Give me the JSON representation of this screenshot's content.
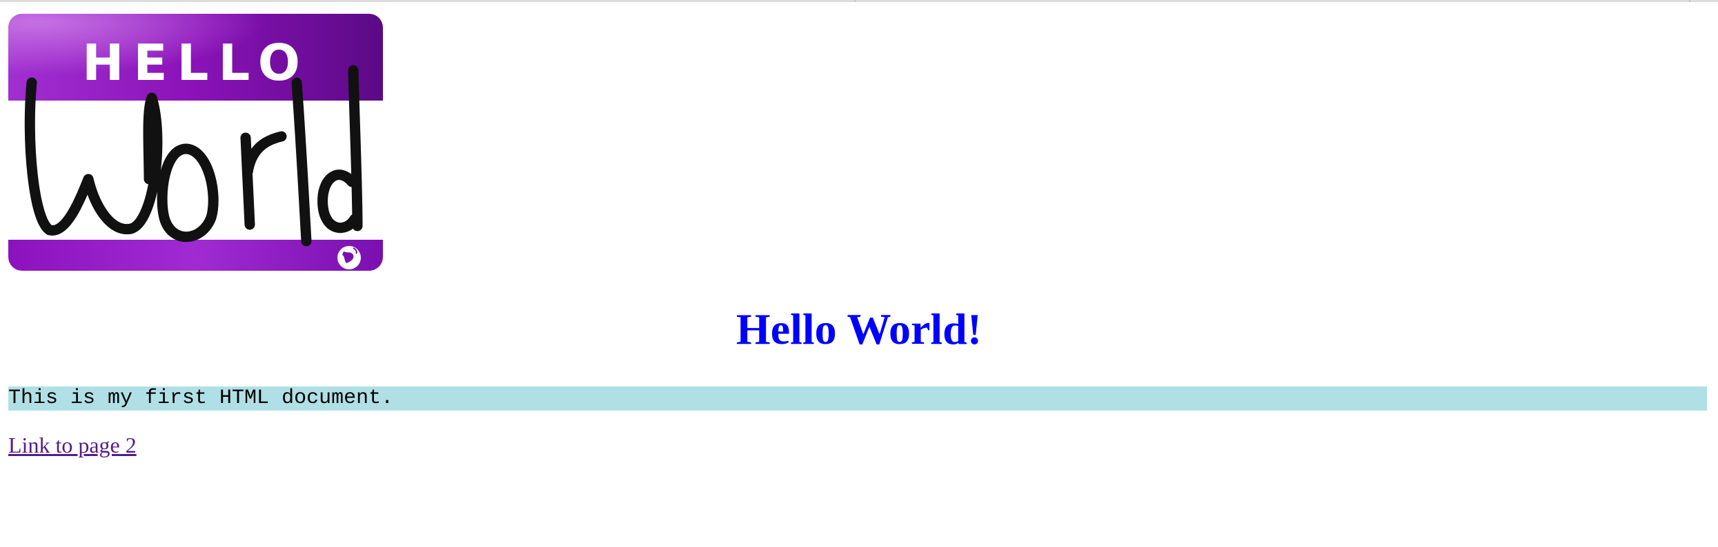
{
  "logo": {
    "title_text": "HELLO",
    "handwritten_text": "World",
    "accent_color": "#8a12b8",
    "accent_dark": "#5b0a86",
    "badge_icon": "globe-icon"
  },
  "heading": {
    "text": "Hello World!",
    "color": "#0000ff"
  },
  "intro": {
    "text": "This is my first HTML document.",
    "background": "#b0e0e6"
  },
  "link": {
    "text": "Link to page 2",
    "color": "#551a8b"
  }
}
